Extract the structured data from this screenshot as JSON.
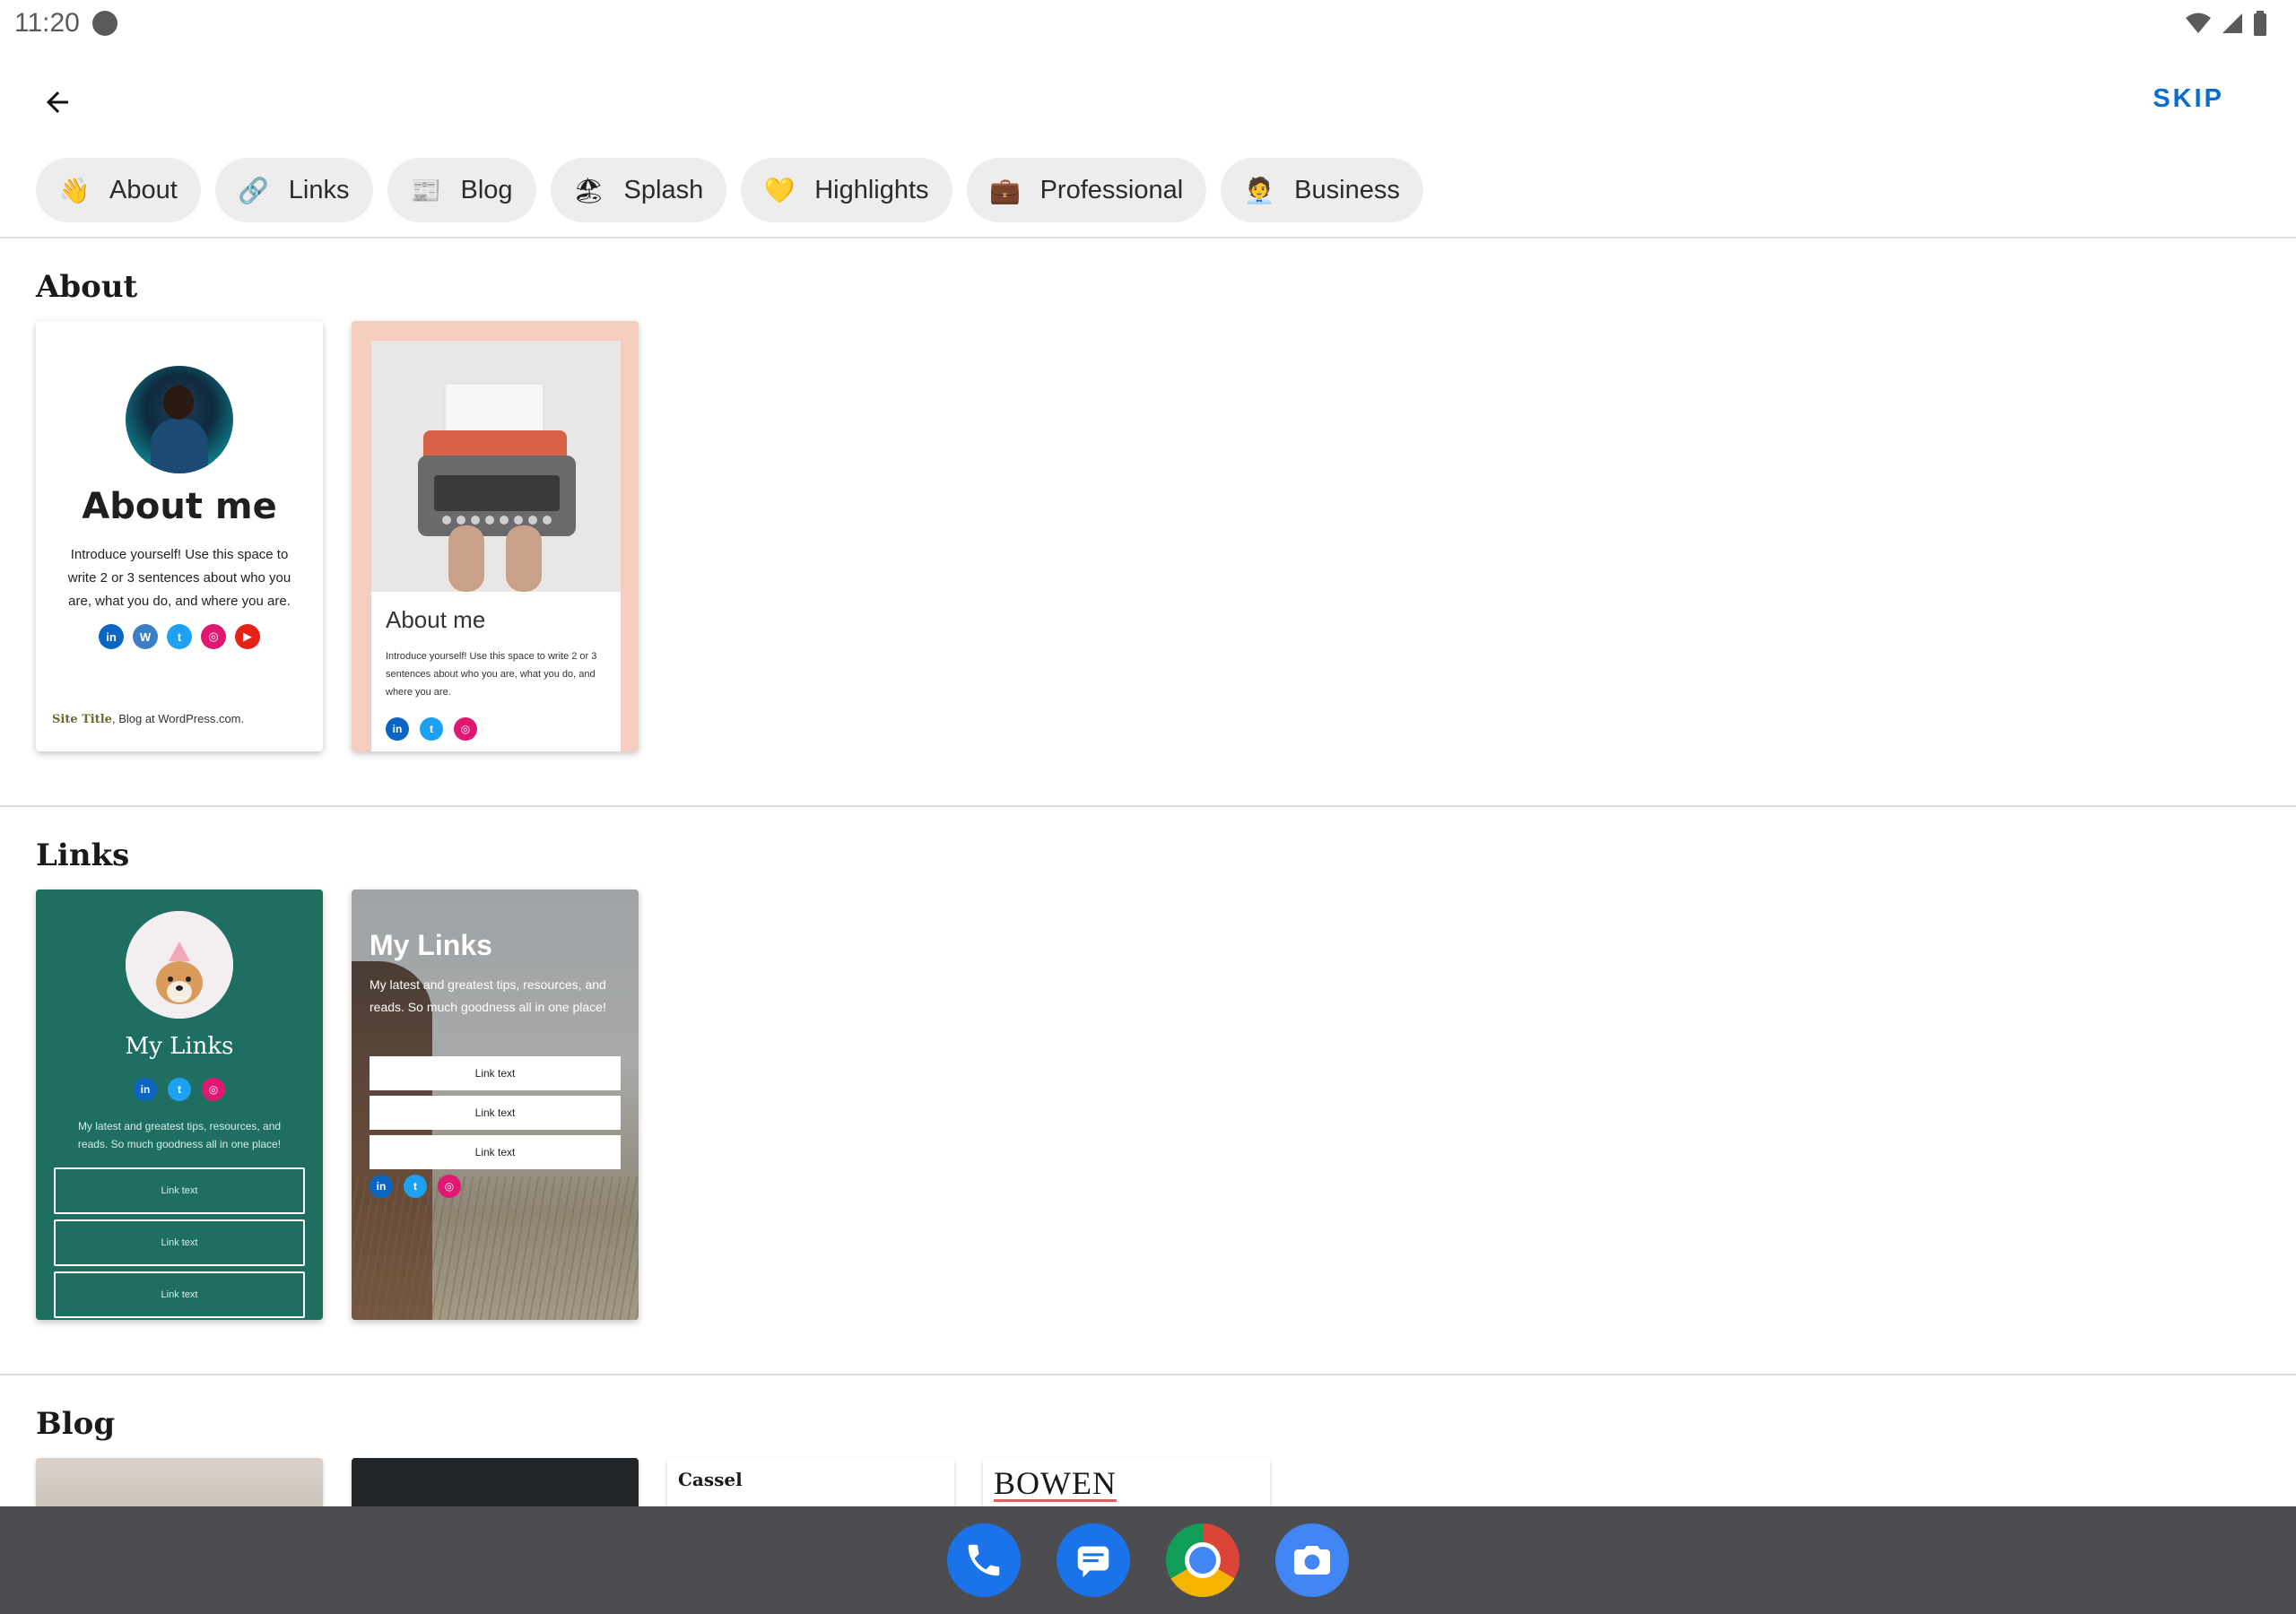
{
  "status_bar": {
    "time": "11:20"
  },
  "top_bar": {
    "skip_label": "SKIP"
  },
  "chips": [
    {
      "label": "About",
      "emoji": "👋"
    },
    {
      "label": "Links",
      "emoji": "🔗"
    },
    {
      "label": "Blog",
      "emoji": "📰"
    },
    {
      "label": "Splash",
      "emoji": "🏖"
    },
    {
      "label": "Highlights",
      "emoji": "💛"
    },
    {
      "label": "Professional",
      "emoji": "💼"
    },
    {
      "label": "Business",
      "emoji": "🧑‍💼"
    }
  ],
  "sections": {
    "about": {
      "title": "About",
      "card1": {
        "title": "About me",
        "desc": "Introduce yourself! Use this space to write 2 or 3 sentences about who you are, what you do, and where you are.",
        "footer_site": "Site Title",
        "footer_rest": ", Blog at WordPress.com."
      },
      "card2": {
        "title": "About me",
        "desc": "Introduce yourself! Use this space to write 2 or 3 sentences about who you are, what you do, and where you are."
      }
    },
    "links": {
      "title": "Links",
      "card1": {
        "title": "My Links",
        "desc": "My latest and greatest tips, resources, and reads. So much goodness all in one place!",
        "buttons": [
          "Link text",
          "Link text",
          "Link text"
        ]
      },
      "card2": {
        "title": "My Links",
        "desc": "My latest and greatest tips, resources, and reads. So much goodness all in one place!",
        "buttons": [
          "Link text",
          "Link text",
          "Link text"
        ]
      }
    },
    "blog": {
      "title": "Blog",
      "card3_title": "Cassel",
      "card4_title": "BOWEN"
    }
  },
  "colors": {
    "accent": "#0a6ec8",
    "links_green": "#1e6f62",
    "about_peach": "#f5cdbf",
    "navbar": "#4d4d51"
  }
}
